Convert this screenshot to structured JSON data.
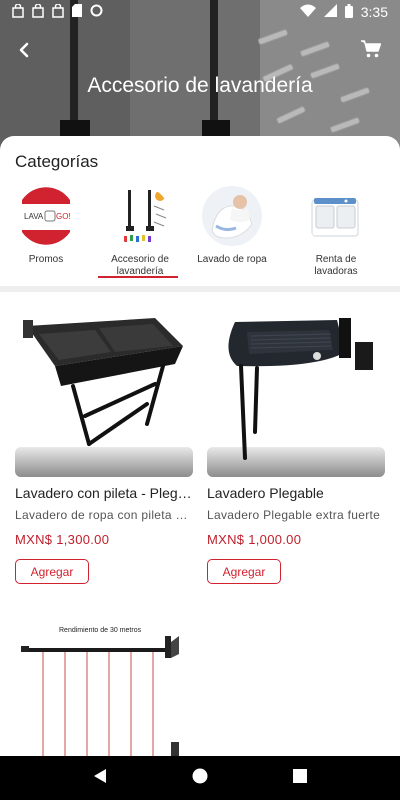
{
  "status_bar": {
    "time": "3:35",
    "icons": [
      "shopping-bag-icon",
      "shopping-bag-icon",
      "shopping-bag-icon",
      "sd-card-icon",
      "sync-icon",
      "wifi-icon",
      "signal-icon",
      "battery-icon"
    ]
  },
  "header": {
    "title": "Accesorio de lavandería",
    "back_icon": "back-arrow-icon",
    "cart_icon": "cart-icon"
  },
  "categories": {
    "title": "Categorías",
    "items": [
      {
        "label": "Promos",
        "icon": "lava-go-logo",
        "logo_text_a": "LAVA",
        "logo_text_b": "GO!"
      },
      {
        "label": "Accesorio de lavandería",
        "icon": "laundry-accessory-image",
        "selected": true
      },
      {
        "label": "Lavado de ropa",
        "icon": "laundry-clothes-image"
      },
      {
        "label": "Renta de lavadoras",
        "icon": "washing-machine-image"
      }
    ],
    "accent_color": "#d0222f"
  },
  "products": [
    {
      "name": "Lavadero con pileta - Plegable",
      "description": "Lavadero de ropa con pileta plegable",
      "price": "MXN$ 1,300.00",
      "button": "Agregar"
    },
    {
      "name": "Lavadero Plegable",
      "description": "Lavadero Plegable extra fuerte",
      "price": "MXN$ 1,000.00",
      "button": "Agregar"
    },
    {
      "image_caption": "Rendimiento de 30 metros"
    }
  ],
  "nav_bar": {
    "icons": [
      "nav-back-icon",
      "nav-home-icon",
      "nav-recents-icon"
    ]
  }
}
